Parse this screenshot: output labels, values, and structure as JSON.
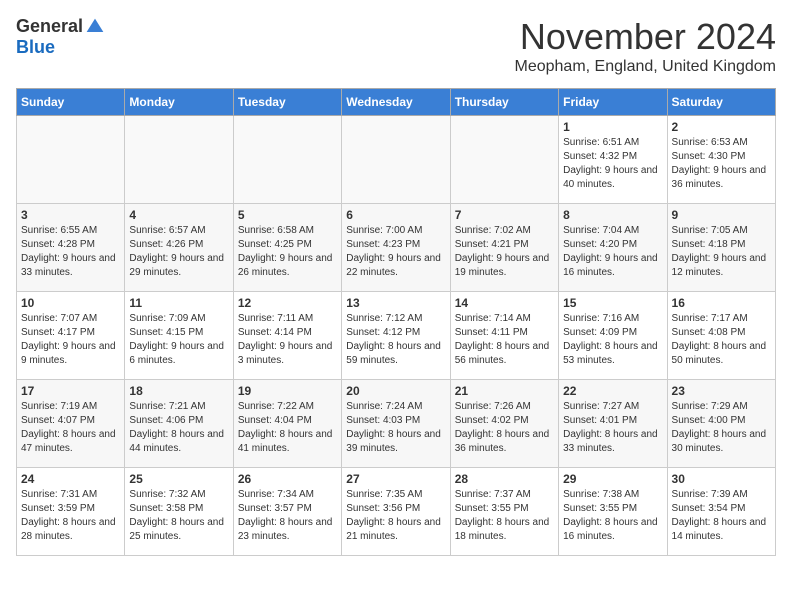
{
  "logo": {
    "general": "General",
    "blue": "Blue"
  },
  "title": "November 2024",
  "location": "Meopham, England, United Kingdom",
  "headers": [
    "Sunday",
    "Monday",
    "Tuesday",
    "Wednesday",
    "Thursday",
    "Friday",
    "Saturday"
  ],
  "weeks": [
    [
      {
        "day": "",
        "detail": ""
      },
      {
        "day": "",
        "detail": ""
      },
      {
        "day": "",
        "detail": ""
      },
      {
        "day": "",
        "detail": ""
      },
      {
        "day": "",
        "detail": ""
      },
      {
        "day": "1",
        "detail": "Sunrise: 6:51 AM\nSunset: 4:32 PM\nDaylight: 9 hours and 40 minutes."
      },
      {
        "day": "2",
        "detail": "Sunrise: 6:53 AM\nSunset: 4:30 PM\nDaylight: 9 hours and 36 minutes."
      }
    ],
    [
      {
        "day": "3",
        "detail": "Sunrise: 6:55 AM\nSunset: 4:28 PM\nDaylight: 9 hours and 33 minutes."
      },
      {
        "day": "4",
        "detail": "Sunrise: 6:57 AM\nSunset: 4:26 PM\nDaylight: 9 hours and 29 minutes."
      },
      {
        "day": "5",
        "detail": "Sunrise: 6:58 AM\nSunset: 4:25 PM\nDaylight: 9 hours and 26 minutes."
      },
      {
        "day": "6",
        "detail": "Sunrise: 7:00 AM\nSunset: 4:23 PM\nDaylight: 9 hours and 22 minutes."
      },
      {
        "day": "7",
        "detail": "Sunrise: 7:02 AM\nSunset: 4:21 PM\nDaylight: 9 hours and 19 minutes."
      },
      {
        "day": "8",
        "detail": "Sunrise: 7:04 AM\nSunset: 4:20 PM\nDaylight: 9 hours and 16 minutes."
      },
      {
        "day": "9",
        "detail": "Sunrise: 7:05 AM\nSunset: 4:18 PM\nDaylight: 9 hours and 12 minutes."
      }
    ],
    [
      {
        "day": "10",
        "detail": "Sunrise: 7:07 AM\nSunset: 4:17 PM\nDaylight: 9 hours and 9 minutes."
      },
      {
        "day": "11",
        "detail": "Sunrise: 7:09 AM\nSunset: 4:15 PM\nDaylight: 9 hours and 6 minutes."
      },
      {
        "day": "12",
        "detail": "Sunrise: 7:11 AM\nSunset: 4:14 PM\nDaylight: 9 hours and 3 minutes."
      },
      {
        "day": "13",
        "detail": "Sunrise: 7:12 AM\nSunset: 4:12 PM\nDaylight: 8 hours and 59 minutes."
      },
      {
        "day": "14",
        "detail": "Sunrise: 7:14 AM\nSunset: 4:11 PM\nDaylight: 8 hours and 56 minutes."
      },
      {
        "day": "15",
        "detail": "Sunrise: 7:16 AM\nSunset: 4:09 PM\nDaylight: 8 hours and 53 minutes."
      },
      {
        "day": "16",
        "detail": "Sunrise: 7:17 AM\nSunset: 4:08 PM\nDaylight: 8 hours and 50 minutes."
      }
    ],
    [
      {
        "day": "17",
        "detail": "Sunrise: 7:19 AM\nSunset: 4:07 PM\nDaylight: 8 hours and 47 minutes."
      },
      {
        "day": "18",
        "detail": "Sunrise: 7:21 AM\nSunset: 4:06 PM\nDaylight: 8 hours and 44 minutes."
      },
      {
        "day": "19",
        "detail": "Sunrise: 7:22 AM\nSunset: 4:04 PM\nDaylight: 8 hours and 41 minutes."
      },
      {
        "day": "20",
        "detail": "Sunrise: 7:24 AM\nSunset: 4:03 PM\nDaylight: 8 hours and 39 minutes."
      },
      {
        "day": "21",
        "detail": "Sunrise: 7:26 AM\nSunset: 4:02 PM\nDaylight: 8 hours and 36 minutes."
      },
      {
        "day": "22",
        "detail": "Sunrise: 7:27 AM\nSunset: 4:01 PM\nDaylight: 8 hours and 33 minutes."
      },
      {
        "day": "23",
        "detail": "Sunrise: 7:29 AM\nSunset: 4:00 PM\nDaylight: 8 hours and 30 minutes."
      }
    ],
    [
      {
        "day": "24",
        "detail": "Sunrise: 7:31 AM\nSunset: 3:59 PM\nDaylight: 8 hours and 28 minutes."
      },
      {
        "day": "25",
        "detail": "Sunrise: 7:32 AM\nSunset: 3:58 PM\nDaylight: 8 hours and 25 minutes."
      },
      {
        "day": "26",
        "detail": "Sunrise: 7:34 AM\nSunset: 3:57 PM\nDaylight: 8 hours and 23 minutes."
      },
      {
        "day": "27",
        "detail": "Sunrise: 7:35 AM\nSunset: 3:56 PM\nDaylight: 8 hours and 21 minutes."
      },
      {
        "day": "28",
        "detail": "Sunrise: 7:37 AM\nSunset: 3:55 PM\nDaylight: 8 hours and 18 minutes."
      },
      {
        "day": "29",
        "detail": "Sunrise: 7:38 AM\nSunset: 3:55 PM\nDaylight: 8 hours and 16 minutes."
      },
      {
        "day": "30",
        "detail": "Sunrise: 7:39 AM\nSunset: 3:54 PM\nDaylight: 8 hours and 14 minutes."
      }
    ]
  ]
}
